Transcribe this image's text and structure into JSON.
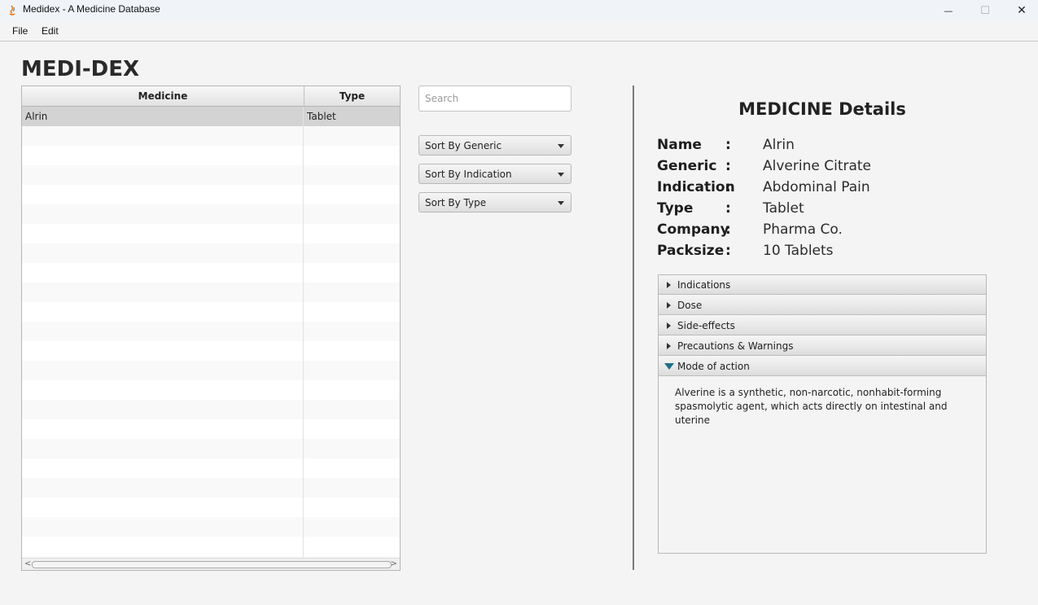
{
  "window": {
    "title": "Medidex - A Medicine Database",
    "minimize_glyph": "—",
    "maximize_glyph": "☐",
    "close_glyph": "✕"
  },
  "menu": {
    "items": [
      "File",
      "Edit"
    ]
  },
  "heading": "MEDI-DEX",
  "table": {
    "columns": [
      "Medicine",
      "Type"
    ],
    "rows": [
      {
        "medicine": "Alrin",
        "type": "Tablet"
      }
    ],
    "scroll_left": "<",
    "scroll_right": ">"
  },
  "search": {
    "placeholder": "Search",
    "value": ""
  },
  "sorts": [
    "Sort By Generic",
    "Sort By Indication",
    "Sort By Type"
  ],
  "details": {
    "title": "MEDICINE Details",
    "fields": [
      {
        "label": "Name",
        "value": "Alrin"
      },
      {
        "label": "Generic",
        "value": "Alverine Citrate"
      },
      {
        "label": "Indication",
        "value": "Abdominal Pain"
      },
      {
        "label": "Type",
        "value": "Tablet"
      },
      {
        "label": "Company",
        "value": "Pharma Co."
      },
      {
        "label": "Packsize",
        "value": "10 Tablets"
      }
    ],
    "separator": ":"
  },
  "accordion": {
    "panes": [
      "Indications",
      "Dose",
      "Side-effects",
      "Precautions & Warnings",
      "Mode of action"
    ],
    "expanded": "Mode of action",
    "content": "Alverine is a synthetic, non-narcotic, nonhabit-forming spasmolytic agent, which acts directly on intestinal and uterine",
    "expanded_color": "#1f6e8c"
  }
}
